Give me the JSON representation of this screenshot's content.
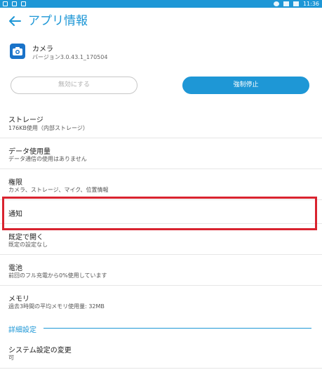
{
  "status_bar": {
    "time": "11:36"
  },
  "header": {
    "title": "アプリ情報"
  },
  "app": {
    "name": "カメラ",
    "version": "バージョン3.0.43.1_170504"
  },
  "buttons": {
    "disable": "無効にする",
    "force_stop": "強制停止"
  },
  "items": [
    {
      "title": "ストレージ",
      "subtitle": "176KB使用（内部ストレージ）"
    },
    {
      "title": "データ使用量",
      "subtitle": "データ通信の使用はありません"
    },
    {
      "title": "権限",
      "subtitle": "カメラ、ストレージ、マイク、位置情報"
    },
    {
      "title": "通知",
      "subtitle": ""
    },
    {
      "title": "既定で開く",
      "subtitle": "既定の設定なし"
    },
    {
      "title": "電池",
      "subtitle": "前回のフル充電から0%使用しています"
    },
    {
      "title": "メモリ",
      "subtitle": "過去3時間の平均メモリ使用量: 32MB"
    }
  ],
  "section": {
    "title": "詳細設定"
  },
  "advanced_items": [
    {
      "title": "システム設定の変更",
      "subtitle": "可"
    }
  ],
  "colors": {
    "accent": "#1e97d6",
    "highlight": "#d9232f"
  }
}
